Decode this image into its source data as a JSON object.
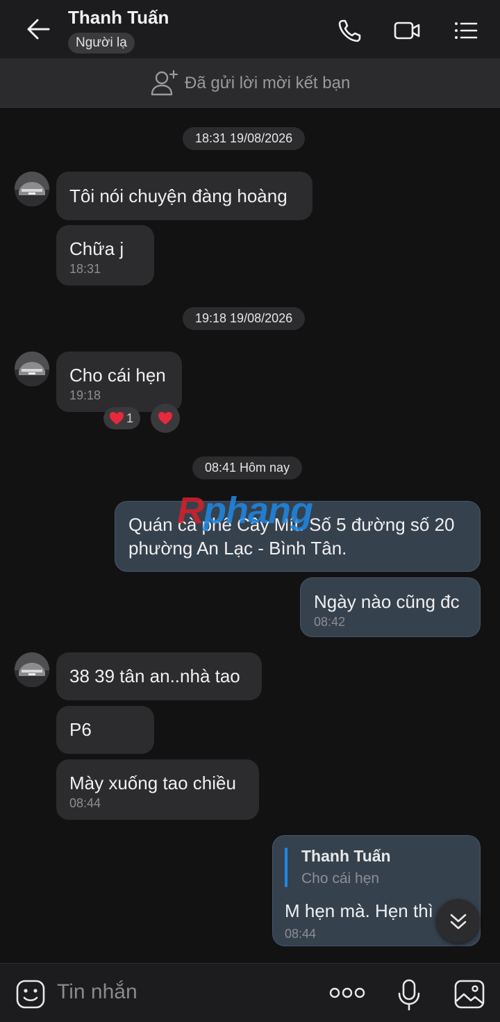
{
  "header": {
    "title": "Thanh Tuấn",
    "badge": "Người lạ",
    "icons": [
      "back-arrow-icon",
      "phone-icon",
      "video-call-icon",
      "menu-list-icon"
    ]
  },
  "friend_request": {
    "text": "Đã gửi lời mời kết bạn",
    "icon": "add-friend-icon"
  },
  "watermark": {
    "part1": "R",
    "part2": "phang"
  },
  "timestamps": [
    "18:31 19/08/2026",
    "19:18 19/08/2026",
    "08:41 Hôm nay"
  ],
  "messages": {
    "m1": {
      "text": "Tôi nói chuyện đàng hoàng"
    },
    "m2": {
      "text": "Chữa j",
      "time": "18:31"
    },
    "m3": {
      "text": "Cho cái hẹn",
      "time": "19:18",
      "reaction_count": "1"
    },
    "m4": {
      "line1": "Quán cà phê Cây Mít. Số 5 đường số 20",
      "line2": "phường An Lạc - Bình Tân."
    },
    "m5": {
      "text": "Ngày nào cũng đc",
      "time": "08:42"
    },
    "m6": {
      "text": "38 39 tân an..nhà tao"
    },
    "m7": {
      "text": "P6"
    },
    "m8": {
      "text": "Mày xuống tao chiều",
      "time": "08:44"
    },
    "m9": {
      "quote_name": "Thanh Tuấn",
      "quote_text": "Cho cái hẹn",
      "text": "M hẹn mà. Hẹn thì",
      "time": "08:44"
    }
  },
  "input": {
    "placeholder": "Tin nhắn"
  },
  "colors": {
    "background": "#121212",
    "incoming_bubble": "#2c2c2e",
    "outgoing_bubble": "#36414e",
    "accent": "#1e88e5",
    "heart": "#e8283c"
  }
}
